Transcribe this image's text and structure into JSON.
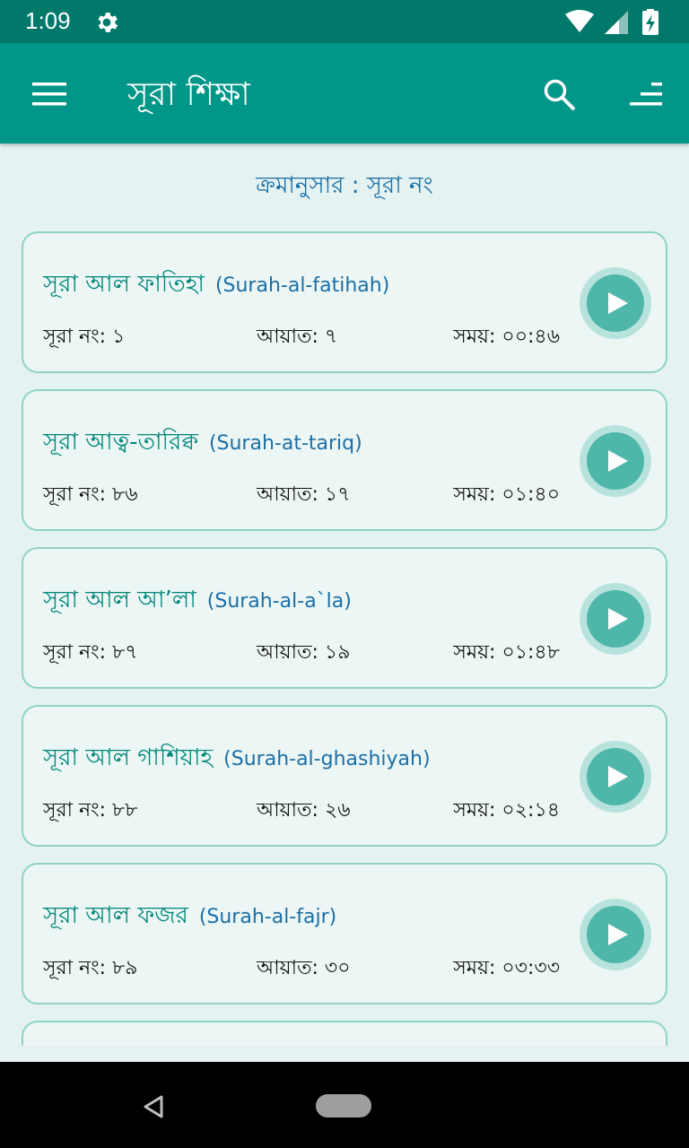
{
  "status_bar": {
    "time": "1:09",
    "icons": [
      "gear-icon",
      "wifi-icon",
      "signal-icon",
      "battery-charging-icon"
    ]
  },
  "app_bar": {
    "title": "সূরা শিক্ষা",
    "icons": [
      "menu-icon",
      "search-icon",
      "sort-icon"
    ]
  },
  "sort_label": "ক্রমানুসার : সূরা নং",
  "surahs": [
    {
      "name_bn": "সূরা আল ফাতিহা",
      "name_en": "(Surah-al-fatihah)",
      "number": "সূরা নং: ১",
      "ayat": "আয়াত: ৭",
      "duration": "সময়: ০০:৪৬"
    },
    {
      "name_bn": "সূরা আত্ব-তারিক্ব",
      "name_en": "(Surah-at-tariq)",
      "number": "সূরা নং: ৮৬",
      "ayat": "আয়াত: ১৭",
      "duration": "সময়: ০১:৪০"
    },
    {
      "name_bn": "সূরা আল আ’লা",
      "name_en": "(Surah-al-a`la)",
      "number": "সূরা নং: ৮৭",
      "ayat": "আয়াত: ১৯",
      "duration": "সময়: ০১:৪৮"
    },
    {
      "name_bn": "সূরা আল গাশিয়াহ",
      "name_en": "(Surah-al-ghashiyah)",
      "number": "সূরা নং: ৮৮",
      "ayat": "আয়াত: ২৬",
      "duration": "সময়: ০২:১৪"
    },
    {
      "name_bn": "সূরা আল ফজর",
      "name_en": "(Surah-al-fajr)",
      "number": "সূরা নং: ৮৯",
      "ayat": "আয়াত: ৩০",
      "duration": "সময়: ০৩:৩৩"
    }
  ],
  "colors": {
    "primary": "#009688",
    "primary_dark": "#00796b",
    "title_green": "#00877a",
    "title_blue": "#1b6fa6",
    "card_border": "#8fd3c5",
    "play_button": "#4fb7aa"
  }
}
